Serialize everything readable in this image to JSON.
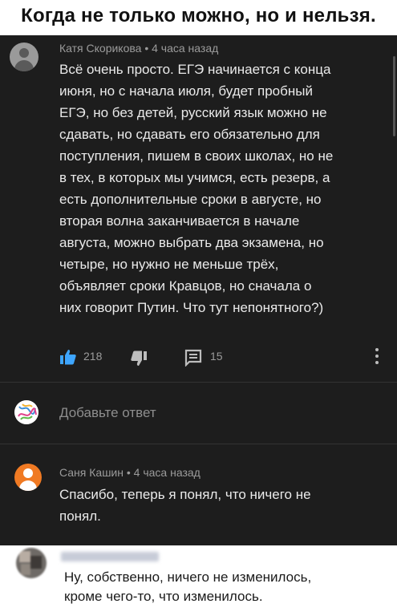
{
  "header": {
    "title": "Когда не только можно, но и нельзя."
  },
  "comment1": {
    "author": "Катя Скорикова",
    "time": "4 часа назад",
    "lines": [
      "Всё очень просто. ЕГЭ начинается с конца",
      "июня, но с начала июля, будет пробный",
      "ЕГЭ, но без детей, русский язык можно не",
      "сдавать, но сдавать его обязательно для",
      "поступления, пишем в своих школах, но не",
      "в тех, в которых мы учимся, есть резерв, а",
      "есть дополнительные сроки в августе, но",
      "вторая волна заканчивается в начале",
      "августа, можно выбрать два экзамена, но",
      "четыре, но нужно не меньше трёх,",
      "объявляет сроки Кравцов, но сначала о",
      "них говорит Путин. Что тут непонятного?)"
    ],
    "likes": "218",
    "replies": "15"
  },
  "reply_box": {
    "placeholder": "Добавьте ответ"
  },
  "comment2": {
    "author": "Саня Кашин",
    "time": "4 часа назад",
    "lines": [
      "Спасибо, теперь я понял, что ничего не",
      "понял."
    ]
  },
  "comment3": {
    "lines": [
      "Ну, собственно, ничего не изменилось,",
      "кроме чего-то, что изменилось."
    ]
  },
  "icons": {
    "like": "thumbs-up-icon",
    "dislike": "thumbs-down-icon",
    "replies": "comment-icon",
    "more": "more-vertical-icon"
  },
  "colors": {
    "background_dark": "#1d1d1d",
    "like_accent": "#3ea6ff",
    "avatar2": "#f07a23"
  }
}
